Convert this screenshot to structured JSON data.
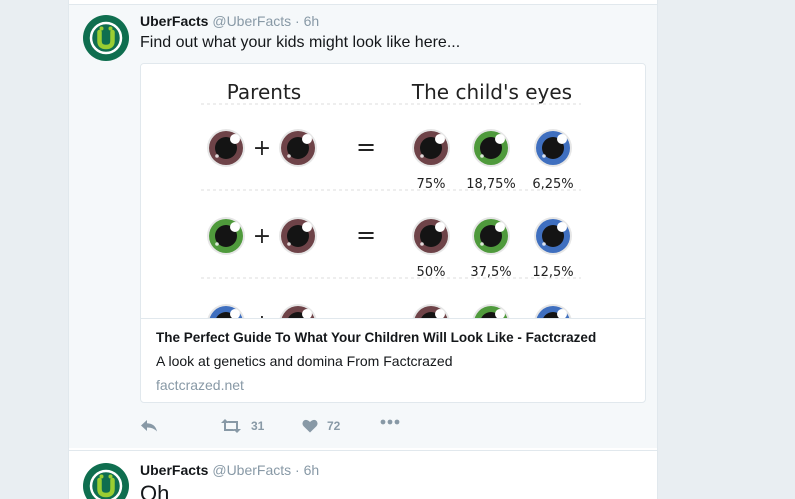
{
  "colors": {
    "accent": "#1da1f2",
    "meta_gray": "#8899a6",
    "avatar_bg": "#0f6e4f",
    "avatar_ring": "#ffffff",
    "avatar_logo": "#9acd32",
    "brown_eye": "#6e4348",
    "green_eye": "#4f9a3c",
    "blue_eye": "#3f6fbf"
  },
  "tweets": [
    {
      "author": "UberFacts",
      "handle": "@UberFacts",
      "separator": "·",
      "time": "6h",
      "text": "Find out what your kids might look like here...",
      "avatar_icon": "uberfacts-logo-icon",
      "card": {
        "image": {
          "header_left": "Parents",
          "header_right": "The child's eyes",
          "plus": "+",
          "equals": "=",
          "rows": [
            {
              "parents": [
                "brown",
                "brown"
              ],
              "children": [
                {
                  "color": "brown",
                  "percent": "75%"
                },
                {
                  "color": "green",
                  "percent": "18,75%"
                },
                {
                  "color": "blue",
                  "percent": "6,25%"
                }
              ]
            },
            {
              "parents": [
                "green",
                "brown"
              ],
              "children": [
                {
                  "color": "brown",
                  "percent": "50%"
                },
                {
                  "color": "green",
                  "percent": "37,5%"
                },
                {
                  "color": "blue",
                  "percent": "12,5%"
                }
              ]
            },
            {
              "parents": [
                "blue",
                "brown"
              ],
              "children": [
                {
                  "color": "brown",
                  "percent": ""
                },
                {
                  "color": "green",
                  "percent": ""
                },
                {
                  "color": "blue",
                  "percent": ""
                }
              ]
            }
          ]
        },
        "title": "The Perfect Guide To What Your Children Will Look Like - Factcrazed",
        "description": "A look at genetics and domina From Factcrazed",
        "domain": "factcrazed.net"
      },
      "actions": {
        "reply_icon": "reply-icon",
        "retweet_icon": "retweet-icon",
        "retweet_count": "31",
        "like_icon": "heart-icon",
        "like_count": "72",
        "more_icon": "more-dots-icon"
      }
    },
    {
      "author": "UberFacts",
      "handle": "@UberFacts",
      "separator": "·",
      "time": "6h",
      "text": "Oh",
      "avatar_icon": "uberfacts-logo-icon"
    }
  ]
}
